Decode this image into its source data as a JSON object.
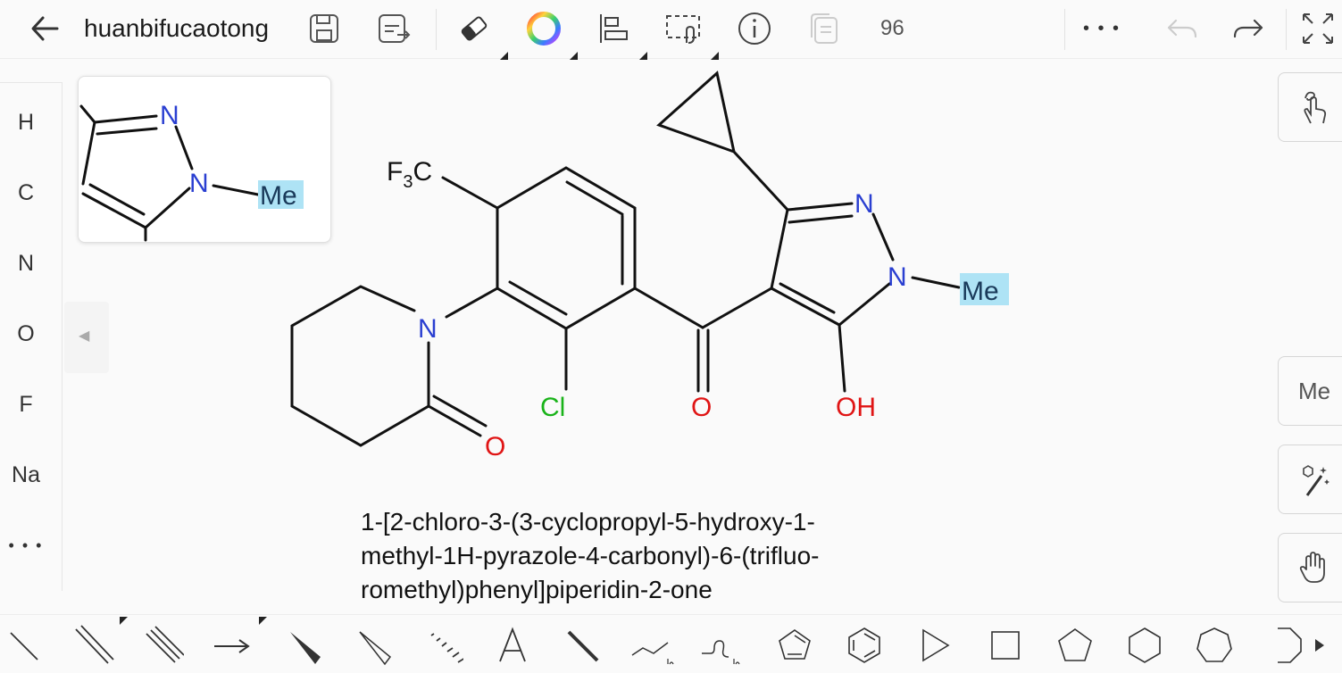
{
  "document": {
    "title": "huanbifucaotong",
    "zoom": "96"
  },
  "toolbar": {
    "icons": [
      "back-arrow-icon",
      "save-icon",
      "save-as-icon",
      "eraser-icon",
      "color-wheel-icon",
      "align-icon",
      "lasso-select-icon",
      "info-icon",
      "copy-icon",
      "more-icon",
      "undo-icon",
      "redo-icon",
      "fullscreen-icon"
    ],
    "more_label": "• • •"
  },
  "element_palette": {
    "items": [
      "H",
      "C",
      "N",
      "O",
      "F",
      "Na"
    ],
    "more_label": "• • •"
  },
  "right_tools": {
    "me_label": "Me"
  },
  "molecule": {
    "atoms": {
      "cf3": "F3C",
      "n_piperidinone": "N",
      "o_lactam": "O",
      "cl": "Cl",
      "o_ketone": "O",
      "n2_pyrazole": "N",
      "n1_pyrazole": "N",
      "methyl": "Me",
      "hydroxyl": "OH"
    },
    "iupac_name_lines": [
      "1-[2-chloro-3-(3-cyclopropyl-5-hydroxy-1-",
      "methyl-1H-pyrazole-4-carbonyl)-6-(trifluo-",
      "romethyl)phenyl]piperidin-2-one"
    ]
  },
  "preview": {
    "atoms": {
      "n_top": "N",
      "n_bottom": "N",
      "methyl": "Me"
    }
  },
  "colors": {
    "nitrogen": "#2a3fd1",
    "oxygen": "#e01515",
    "chlorine": "#19b319",
    "highlight": "#aee3f5",
    "accent_text": "#1a1a1a"
  },
  "bottom_tools": [
    "single-bond-icon",
    "double-bond-icon",
    "triple-bond-icon",
    "arrow-icon",
    "wedge-bond-icon",
    "hashed-wedge-icon",
    "hash-bond-icon",
    "text-icon",
    "bold-bond-icon",
    "chain-icon",
    "wavy-chain-icon",
    "cyclopentadiene-icon",
    "benzene-icon",
    "triangle-icon",
    "square-icon",
    "pentagon-icon",
    "hexagon-icon",
    "heptagon-icon",
    "octagon-icon",
    "scroll-right-icon"
  ]
}
